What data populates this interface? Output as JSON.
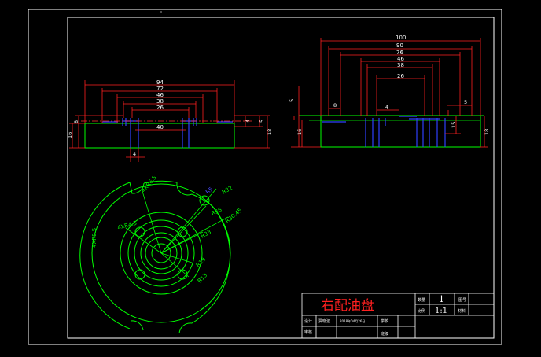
{
  "front_view": {
    "widths": [
      "94",
      "72",
      "46",
      "38",
      "26",
      "40"
    ],
    "left_heights": [
      "8",
      "16"
    ],
    "right_heights": [
      "4",
      "5",
      "18"
    ],
    "bottom_width": "4"
  },
  "side_view": {
    "widths": [
      "100",
      "90",
      "76",
      "46",
      "38",
      "26"
    ],
    "small_widths": [
      "8",
      "4",
      "5"
    ],
    "left_heights": [
      "5",
      "16"
    ],
    "right_heights": [
      "15",
      "18"
    ]
  },
  "plan_view": {
    "labels": [
      "4XR6.5",
      "R5",
      "R32",
      "R36",
      "R30.45",
      "R33",
      "4XR8.5",
      "4XR4.5",
      "R19",
      "R13"
    ]
  },
  "title_block": {
    "part_name": "右配油盘",
    "qty_label": "数量",
    "qty_value": "1",
    "scale_label": "比例",
    "scale_value": "1:1",
    "sheet_label": "图号",
    "material_label": "材料",
    "designer_label": "设计",
    "checker_label": "审核",
    "designer_name": "贾晓波",
    "date_value": "2018年04月26日",
    "school_label": "学校",
    "class_label": "班级"
  }
}
